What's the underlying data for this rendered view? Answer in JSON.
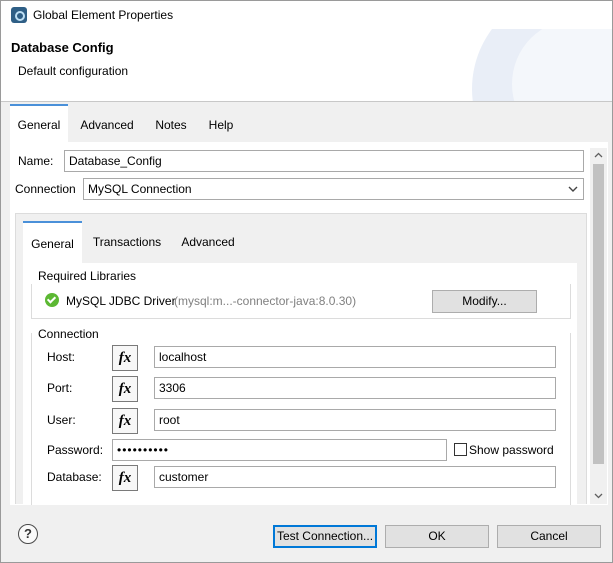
{
  "window": {
    "title": "Global Element Properties"
  },
  "header": {
    "heading": "Database Config",
    "subheading": "Default configuration"
  },
  "outer_tabs": [
    {
      "label": "General",
      "active": true
    },
    {
      "label": "Advanced",
      "active": false
    },
    {
      "label": "Notes",
      "active": false
    },
    {
      "label": "Help",
      "active": false
    }
  ],
  "form": {
    "name_label": "Name:",
    "name_value": "Database_Config",
    "connection_label": "Connection",
    "connection_value": "MySQL Connection"
  },
  "inner_tabs": [
    {
      "label": "General",
      "active": true
    },
    {
      "label": "Transactions",
      "active": false
    },
    {
      "label": "Advanced",
      "active": false
    }
  ],
  "required_libraries": {
    "title": "Required Libraries",
    "driver_name": "MySQL JDBC Driver",
    "driver_detail": "(mysql:m...-connector-java:8.0.30)",
    "modify_label": "Modify..."
  },
  "connection": {
    "title": "Connection",
    "fx_label": "fx",
    "host_label": "Host:",
    "host_value": "localhost",
    "port_label": "Port:",
    "port_value": "3306",
    "user_label": "User:",
    "user_value": "root",
    "password_label": "Password:",
    "password_value": "••••••••••",
    "show_password_label": "Show password",
    "database_label": "Database:",
    "database_value": "customer"
  },
  "footer": {
    "help_icon": "?",
    "test_connection_label": "Test Connection...",
    "ok_label": "OK",
    "cancel_label": "Cancel"
  },
  "colors": {
    "accent": "#4a90d9",
    "status_ok": "#5cb833",
    "focus": "#0078d7"
  }
}
